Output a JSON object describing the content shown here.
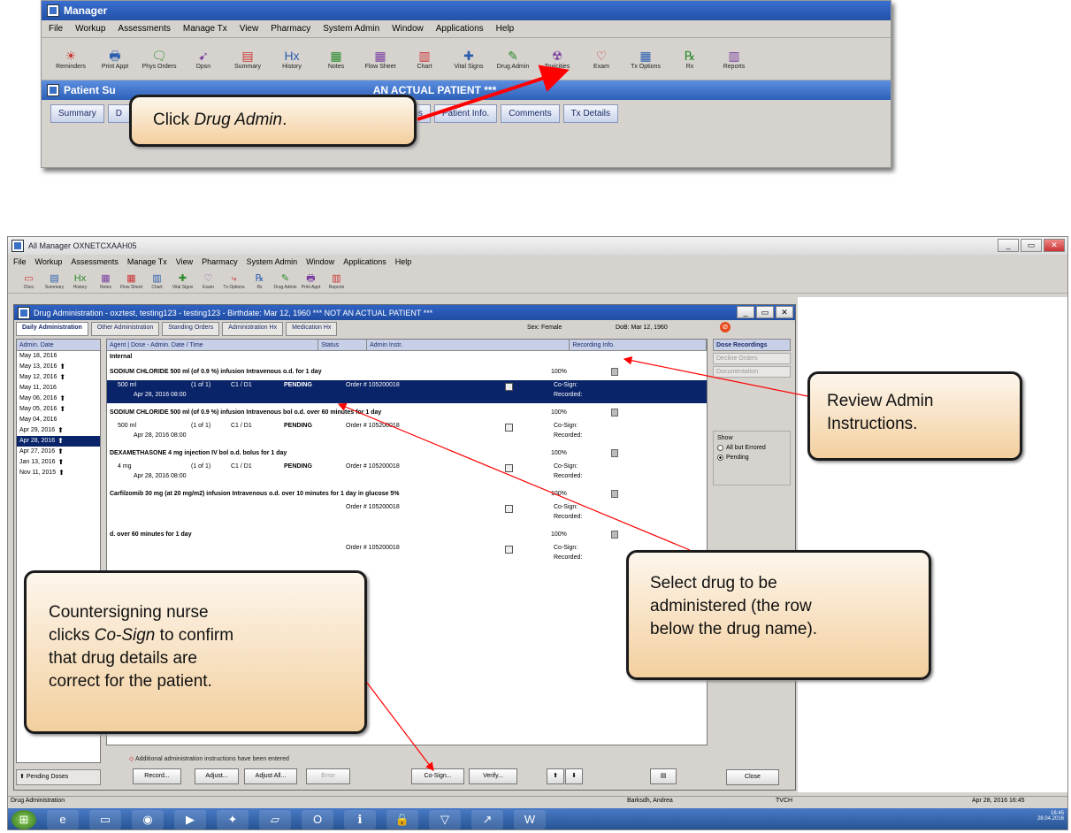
{
  "top_crop": {
    "title": "Manager",
    "menu": [
      "File",
      "Workup",
      "Assessments",
      "Manage Tx",
      "View",
      "Pharmacy",
      "System Admin",
      "Window",
      "Applications",
      "Help"
    ],
    "toolbar": [
      {
        "label": "Reminders",
        "icon": "reminders-icon",
        "glyph": "☀"
      },
      {
        "label": "Print Appt",
        "icon": "print-appt-icon",
        "glyph": "🖶"
      },
      {
        "label": "Phys Orders",
        "icon": "phys-orders-icon",
        "glyph": "🗨"
      },
      {
        "label": "Dpsn",
        "icon": "dpsn-icon",
        "glyph": "➹"
      },
      {
        "label": "Summary",
        "icon": "summary-icon",
        "glyph": "▤"
      },
      {
        "label": "History",
        "icon": "history-icon",
        "glyph": "Hx"
      },
      {
        "label": "Notes",
        "icon": "notes-icon",
        "glyph": "▦"
      },
      {
        "label": "Flow Sheet",
        "icon": "flow-sheet-icon",
        "glyph": "▦"
      },
      {
        "label": "Chart",
        "icon": "chart-icon",
        "glyph": "▥"
      },
      {
        "label": "Vital Signs",
        "icon": "vital-signs-icon",
        "glyph": "✚"
      },
      {
        "label": "Drug Admin",
        "icon": "drug-admin-icon",
        "glyph": "✎"
      },
      {
        "label": "Toxicities",
        "icon": "toxicities-icon",
        "glyph": "☢"
      },
      {
        "label": "Exam",
        "icon": "exam-icon",
        "glyph": "♡"
      },
      {
        "label": "Tx Options",
        "icon": "tx-options-icon",
        "glyph": "▦"
      },
      {
        "label": "Rx",
        "icon": "rx-icon",
        "glyph": "℞"
      },
      {
        "label": "Reports",
        "icon": "reports-icon",
        "glyph": "▥"
      }
    ],
    "subtitle_left": "Patient Su",
    "subtitle_right": "AN ACTUAL PATIENT ***",
    "tabs": [
      "Summary",
      "D",
      "Indications",
      "Patient Info.",
      "Comments",
      "Tx Details"
    ]
  },
  "callouts": {
    "top_pre": "Click ",
    "top_em": "Drug Admin",
    "top_post": ".",
    "review_line1": "Review Admin",
    "review_line2": "Instructions.",
    "select_line1": "Select drug to be",
    "select_line2": "administered (the row",
    "select_line3": "below the drug name).",
    "cosign_line1": "Countersigning nurse",
    "cosign_line2_pre": "clicks ",
    "cosign_line2_em": "Co-Sign",
    "cosign_line2_post": " to confirm",
    "cosign_line3": "that drug details are",
    "cosign_line4": "correct for the patient."
  },
  "main_window": {
    "title": "All Manager OXNETCXAAH05",
    "menu": [
      "File",
      "Workup",
      "Assessments",
      "Manage Tx",
      "View",
      "Pharmacy",
      "System Admin",
      "Window",
      "Applications",
      "Help"
    ],
    "toolbar": [
      {
        "label": "Chec",
        "icon": "folder-icon",
        "glyph": "▭"
      },
      {
        "label": "Summary",
        "icon": "summary-icon",
        "glyph": "▤"
      },
      {
        "label": "History",
        "icon": "history-icon",
        "glyph": "Hx"
      },
      {
        "label": "Notes",
        "icon": "notes-icon",
        "glyph": "▦"
      },
      {
        "label": "Flow Sheet",
        "icon": "flow-sheet-icon",
        "glyph": "▦"
      },
      {
        "label": "Chart",
        "icon": "chart-icon",
        "glyph": "▥"
      },
      {
        "label": "Vital Signs",
        "icon": "vital-signs-icon",
        "glyph": "✚"
      },
      {
        "label": "Exam",
        "icon": "exam-icon",
        "glyph": "♡"
      },
      {
        "label": "Tx Options",
        "icon": "tx-options-icon",
        "glyph": "⤷"
      },
      {
        "label": "Rx",
        "icon": "rx-icon",
        "glyph": "℞"
      },
      {
        "label": "Drug Admin",
        "icon": "drug-admin-icon",
        "glyph": "✎"
      },
      {
        "label": "Print Appt",
        "icon": "print-appt-icon",
        "glyph": "🖶"
      },
      {
        "label": "Reports",
        "icon": "reports-icon",
        "glyph": "▥"
      }
    ]
  },
  "drug_admin": {
    "title": "Drug Administration - oxztest, testing123 - testing123 - Birthdate: Mar 12, 1960 *** NOT AN ACTUAL PATIENT ***",
    "tabs": [
      "Daily Administration",
      "Other Administration",
      "Standing Orders",
      "Administration Hx",
      "Medication Hx"
    ],
    "sex": "Sex: Female",
    "dob": "DoB: Mar 12, 1960",
    "date_list_header": "Admin. Date",
    "dates": [
      {
        "label": "May 18, 2016",
        "hist": false
      },
      {
        "label": "May 13, 2016",
        "hist": true
      },
      {
        "label": "May 12, 2016",
        "hist": true
      },
      {
        "label": "May 11, 2016",
        "hist": false
      },
      {
        "label": "May 06, 2016",
        "hist": true
      },
      {
        "label": "May 05, 2016",
        "hist": true
      },
      {
        "label": "May 04, 2016",
        "hist": false
      },
      {
        "label": "Apr 29, 2016",
        "hist": true
      },
      {
        "label": "Apr 28, 2016",
        "hist": true,
        "selected": true
      },
      {
        "label": "Apr 27, 2016",
        "hist": true
      },
      {
        "label": "Jan 13, 2016",
        "hist": true
      },
      {
        "label": "Nov 11, 2015",
        "hist": true
      }
    ],
    "grid_headers": [
      "Agent | Dose - Admin. Date / Time",
      "Status",
      "Admin Instr.",
      "Recording Info."
    ],
    "group": "Internal",
    "drugs": [
      {
        "name": "SODIUM CHLORIDE 500 ml (of 0.9 %) infusion Intravenous o.d. for 1 day",
        "pct": "100%",
        "dose": "500 ml",
        "count": "(1 of 1)",
        "cycle": "C1 / D1",
        "status": "PENDING",
        "order": "Order # 105200018",
        "datetime": "Apr 28, 2016 08:00",
        "cosign": "Co-Sign:",
        "recorded": "Recorded:",
        "selected": true
      },
      {
        "name": "SODIUM CHLORIDE 500 ml (of 0.9 %) infusion Intravenous bol o.d. over 60 minutes for 1 day",
        "pct": "100%",
        "dose": "500 ml",
        "count": "(1 of 1)",
        "cycle": "C1 / D1",
        "status": "PENDING",
        "order": "Order # 105200018",
        "datetime": "Apr 28, 2016 08:00",
        "cosign": "Co-Sign:",
        "recorded": "Recorded:",
        "selected": false
      },
      {
        "name": "DEXAMETHASONE 4 mg injection IV bol o.d. bolus for 1 day",
        "pct": "100%",
        "dose": "4 mg",
        "count": "(1 of 1)",
        "cycle": "C1 / D1",
        "status": "PENDING",
        "order": "Order # 105200018",
        "datetime": "Apr 28, 2016 08:00",
        "cosign": "Co-Sign:",
        "recorded": "Recorded:",
        "selected": false
      },
      {
        "name": "Carfilzomib 30 mg (at 20 mg/m2) infusion Intravenous o.d. over 10 minutes for 1 day in glucose 5%",
        "pct": "100%",
        "dose": "",
        "count": "",
        "cycle": "",
        "status": "",
        "order": "Order # 105200018",
        "datetime": "",
        "cosign": "Co-Sign:",
        "recorded": "Recorded:",
        "selected": false
      },
      {
        "name": "d. over 60 minutes for 1 day",
        "pct": "100%",
        "dose": "",
        "count": "",
        "cycle": "",
        "status": "",
        "order": "Order # 105200018",
        "datetime": "",
        "cosign": "Co-Sign:",
        "recorded": "Recorded:",
        "selected": false
      }
    ],
    "dose_panel_header": "Dose Recordings",
    "dose_panel_buttons": [
      "Decline Orders",
      "Documentation"
    ],
    "show_label": "Show",
    "show_options": [
      "All but Errored",
      "Pending"
    ],
    "footnote": "Additional administration instructions have been entered",
    "buttons": [
      "Record...",
      "Adjust...",
      "Adjust All...",
      "Error",
      "Co-Sign...",
      "Verify..."
    ],
    "close": "Close",
    "pending_doses": "Pending Doses"
  },
  "statusbar": {
    "left": "Drug Administration",
    "user": "Barksdh, Andrea",
    "site": "TVCH",
    "datetime": "Apr 28, 2016 16:45"
  },
  "clock": {
    "time": "16:45",
    "date": "28.04.2016"
  }
}
